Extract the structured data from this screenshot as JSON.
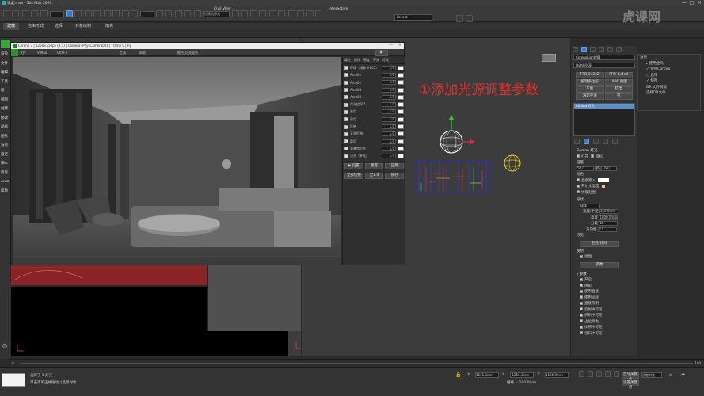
{
  "window": {
    "title": "课桌.max - 3ds Max 2020"
  },
  "menubar": {
    "items": [
      "Civil View",
      "Interactive"
    ]
  },
  "toolbar": {
    "selection_set": "创建选择集",
    "workspace": "Layout"
  },
  "ribbon_tabs": [
    "建模",
    "自由形式",
    "选择",
    "对象绘制",
    "填充"
  ],
  "left_panel": {
    "items": [
      "渲染",
      "文件",
      "编辑",
      "工具",
      "组",
      "视图",
      "创建",
      "修改",
      "动画",
      "图形",
      "渲染",
      "自定",
      "脚本",
      "内容",
      "Arnold",
      "帮助"
    ]
  },
  "vfb": {
    "title": "Corona 7 | 1200×750px (1:1) | Camera: PhysCamera001 | Frame 0 [IR]",
    "menu": [
      "文件",
      "V-Max",
      "Ctrl+T",
      "工具",
      "帮助",
      "颜色_灯光混合"
    ],
    "lightmix_header": [
      "属性",
      "操作",
      "亮度",
      "开关",
      "灯光"
    ],
    "lightmix_rows": [
      {
        "label": "环境（场景 #005）",
        "value": "1.0"
      },
      {
        "label": "Arc001",
        "value": "1.0"
      },
      {
        "label": "Arc002",
        "value": "1.0"
      },
      {
        "label": "Arc003",
        "value": "1.0"
      },
      {
        "label": "Arc004",
        "value": "1.0"
      },
      {
        "label": "灯光组001",
        "value": "1.0"
      },
      {
        "label": "台灯",
        "value": "1.0"
      },
      {
        "label": "吊灯",
        "value": "1.0"
      },
      {
        "label": "灯带",
        "value": "1.0"
      },
      {
        "label": "天花灯带",
        "value": "1.0"
      },
      {
        "label": "筒灯",
        "value": "1.0"
      },
      {
        "label": "背景墙灯光",
        "value": "1.0"
      },
      {
        "label": "顶光（补光）",
        "value": "1.0"
      }
    ],
    "btn_row1": [
      "▶ 设置",
      "重置",
      "应用"
    ],
    "btn_row2": [
      "全部切换",
      "全1.0",
      "保存"
    ]
  },
  "viewport": {
    "annotation": "①添加光源调整参数"
  },
  "command_panel": {
    "object_name": "CoronaLight001",
    "list_title": "修改器列表",
    "buttons": [
      "FFD 2x2x2",
      "FFD 4x4x4",
      "编辑多边形",
      "UVW 贴图",
      "车削",
      "挤出",
      "涡轮平滑",
      "壳"
    ],
    "stack_item": "Corona 灯光",
    "rollout_title": "Corona 灯光",
    "on_label": "打开",
    "targeted_label": "目标",
    "intensity_label": "强度",
    "intensity_value": "50.0",
    "intensity_unit": "默认（W）",
    "color_label": "颜色",
    "direct_color": "直接输入",
    "kelvin": "开尔文温度",
    "texmap": "纹理贴图",
    "shape_label": "形状",
    "shape_value": "球体",
    "width_label": "宽度/半径",
    "width_value": "350.0mm",
    "height_label": "高度",
    "height_value": "1000.0mm",
    "segments_label": "分段",
    "segments_value": "16",
    "directionality_label": "方向性",
    "directionality_value": "0.0",
    "visible_label": "可见",
    "include_exclude": "包含/排除",
    "emit_label": "发射",
    "occlude_label": "遮挡",
    "section2_title": "参数",
    "section3_title": "▸ 参数",
    "rows": [
      "开启",
      "阴影",
      "使用直接",
      "使用间接"
    ],
    "rows_bottom": [
      "直接照明",
      "反射中可见",
      "折射中可见",
      "占位颜色",
      "体积中可见",
      "视口中可见"
    ]
  },
  "top_right_panel": {
    "title": "渲染",
    "rows": [
      "▸ 使用全局",
      "✓ 使用Corona",
      "○ 启用",
      "✓ 使用",
      "DR 文件前缀",
      "选择DR文件"
    ]
  },
  "timeline": {
    "start": "0",
    "end": "100"
  },
  "statusbar": {
    "message": "选择了 1 灯光",
    "hint": "单击或单击并拖动以选择对象",
    "coord_x": "1561.3mm",
    "coord_y": "-1256.3mm",
    "coord_z": "1126.9mm",
    "grid": "栅格 = 100.0mm",
    "autokey": "自动关键点",
    "setkey": "设置关键点",
    "selected": "选定对象"
  },
  "watermark": "虎课网"
}
